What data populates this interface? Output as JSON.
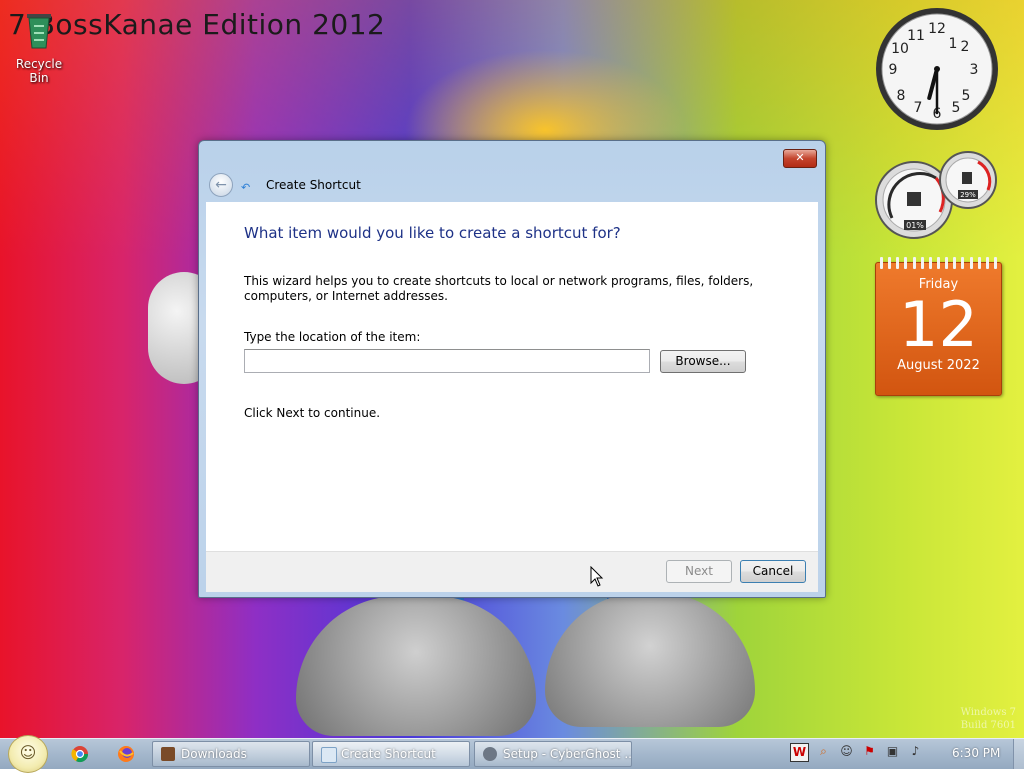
{
  "desktop": {
    "title": "7 BossKanae Edition 2012",
    "recycle_bin_label": "Recycle Bin",
    "watermark_line1": "Windows 7",
    "watermark_line2": "Build 7601"
  },
  "gadgets": {
    "clock": {
      "hour": 6,
      "minute": 30
    },
    "meter": {
      "cpu": "01%",
      "memory": "29%"
    },
    "calendar": {
      "day_name": "Friday",
      "day": "12",
      "month_year": "August 2022"
    }
  },
  "dialog": {
    "title": "Create Shortcut",
    "close_label": "✕",
    "heading": "What item would you like to create a shortcut for?",
    "description": "This wizard helps you to create shortcuts to local or network programs, files, folders, computers, or Internet addresses.",
    "location_label": "Type the location of the item:",
    "location_value": "",
    "browse_label": "Browse...",
    "continue_text": "Click Next to continue.",
    "next_label": "Next",
    "cancel_label": "Cancel"
  },
  "taskbar": {
    "pinned": [
      "chrome-icon",
      "firefox-icon"
    ],
    "tasks": [
      {
        "label": "Downloads",
        "icon": "folder-icon"
      },
      {
        "label": "Create Shortcut",
        "icon": "shortcut-icon"
      },
      {
        "label": "Setup - CyberGhost ...",
        "icon": "cyberghost-icon"
      }
    ],
    "tray_icons": [
      "winamp-icon",
      "search-icon",
      "smiley-icon",
      "network-warning-icon",
      "display-icon",
      "volume-icon"
    ],
    "time": "6:30 PM"
  },
  "colors": {
    "heading": "#1e3287",
    "dialog_frame": "#b9d1ea",
    "calendar": "#e06a20"
  }
}
